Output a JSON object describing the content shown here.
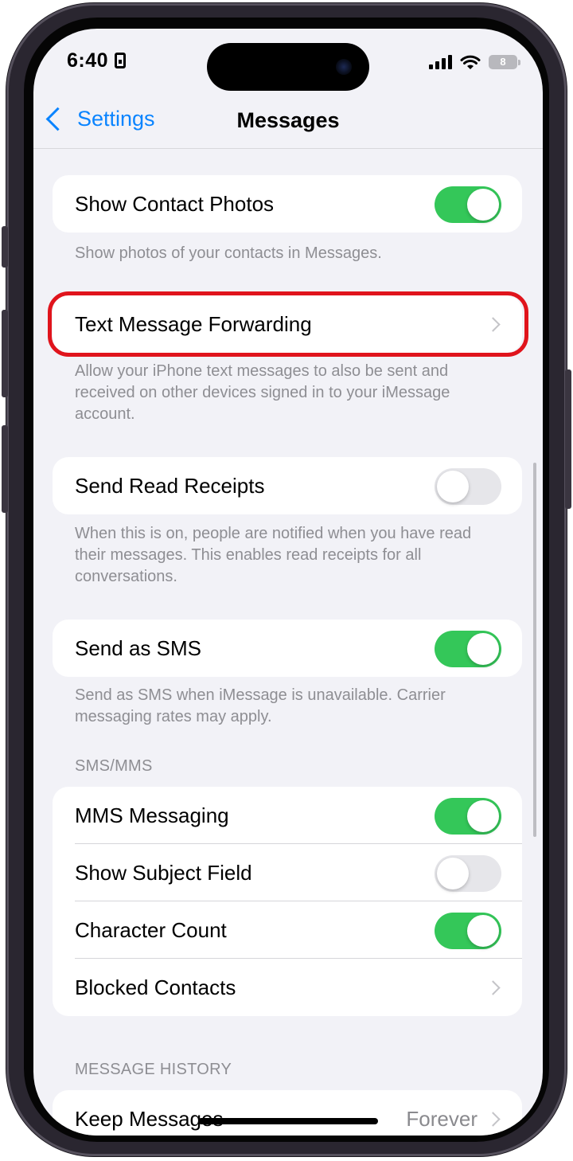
{
  "status_bar": {
    "time": "6:40",
    "battery": "8"
  },
  "navbar": {
    "back_label": "Settings",
    "title": "Messages"
  },
  "show_contact_photos": {
    "label": "Show Contact Photos",
    "toggle_on": true,
    "footer": "Show photos of your contacts in Messages."
  },
  "text_forwarding": {
    "label": "Text Message Forwarding",
    "footer": "Allow your iPhone text messages to also be sent and received on other devices signed in to your iMessage account."
  },
  "read_receipts": {
    "label": "Send Read Receipts",
    "toggle_on": false,
    "footer": "When this is on, people are notified when you have read their messages. This enables read receipts for all conversations."
  },
  "send_sms": {
    "label": "Send as SMS",
    "toggle_on": true,
    "footer": "Send as SMS when iMessage is unavailable. Carrier messaging rates may apply."
  },
  "sms_mms": {
    "header": "SMS/MMS",
    "items": [
      {
        "label": "MMS Messaging",
        "toggle_on": true
      },
      {
        "label": "Show Subject Field",
        "toggle_on": false
      },
      {
        "label": "Character Count",
        "toggle_on": true
      },
      {
        "label": "Blocked Contacts"
      }
    ]
  },
  "message_history": {
    "header": "MESSAGE HISTORY",
    "keep_messages_label": "Keep Messages",
    "keep_messages_value": "Forever"
  },
  "colors": {
    "accent": "#0a84ff",
    "toggle_on": "#34c759",
    "highlight": "#e0141c"
  }
}
